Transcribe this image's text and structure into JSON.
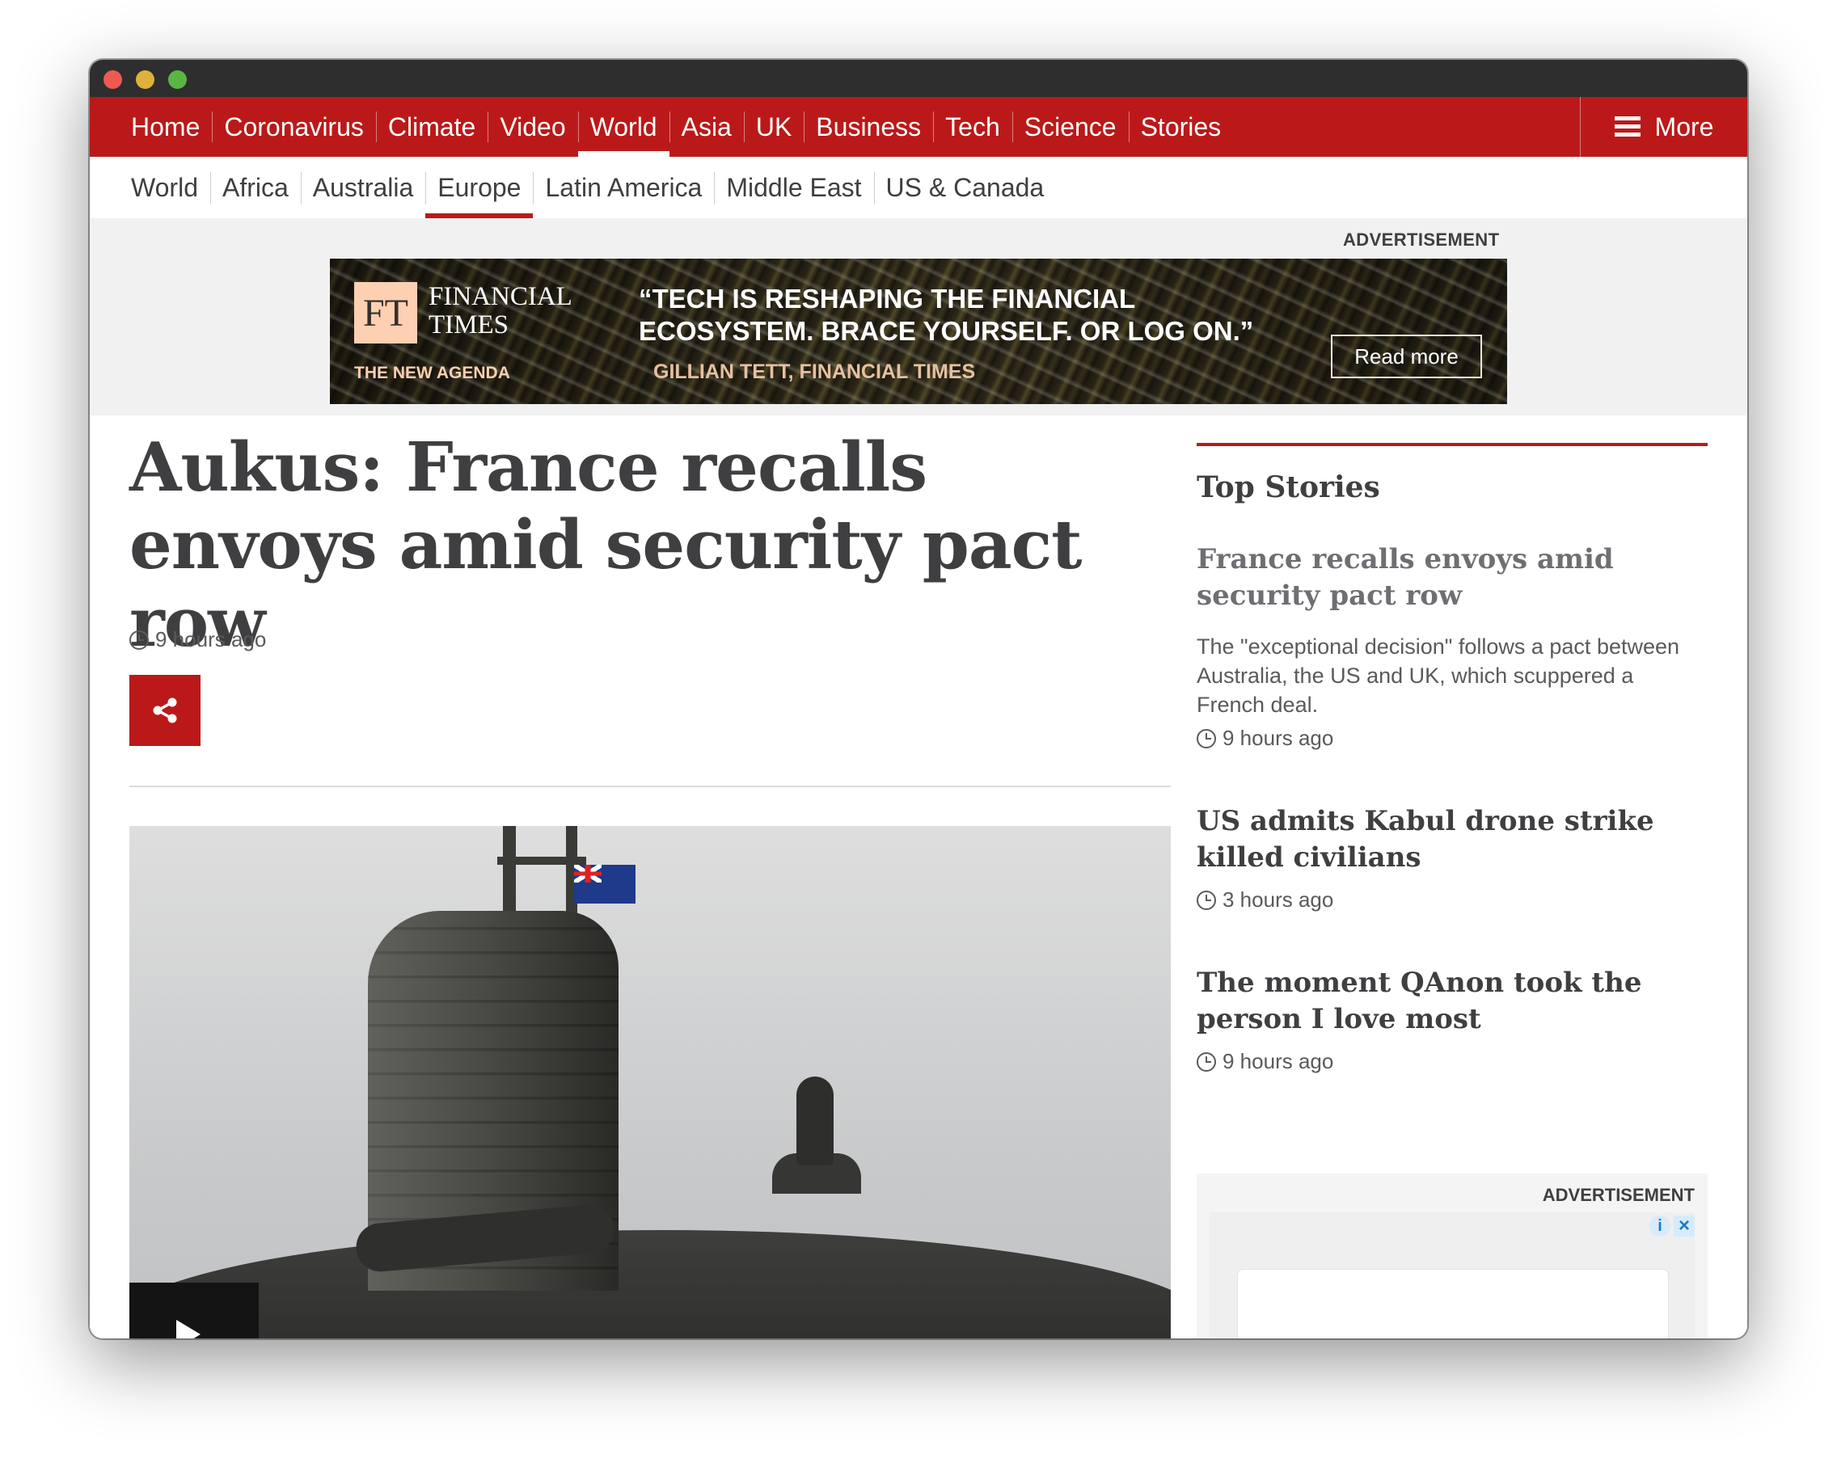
{
  "primary_nav": {
    "items": [
      "Home",
      "Coronavirus",
      "Climate",
      "Video",
      "World",
      "Asia",
      "UK",
      "Business",
      "Tech",
      "Science",
      "Stories"
    ],
    "active": "World",
    "more_label": "More"
  },
  "secondary_nav": {
    "items": [
      "World",
      "Africa",
      "Australia",
      "Europe",
      "Latin America",
      "Middle East",
      "US & Canada"
    ],
    "active": "Europe"
  },
  "top_ad": {
    "label": "ADVERTISEMENT",
    "logo_mark": "FT",
    "brand_line1": "FINANCIAL",
    "brand_line2": "TIMES",
    "tagline": "THE NEW AGENDA",
    "quote": "“TECH IS RESHAPING THE  FINANCIAL\n ECOSYSTEM. BRACE YOURSELF. OR LOG ON.”",
    "attribution": "GILLIAN TETT, FINANCIAL TIMES",
    "cta": "Read more"
  },
  "article": {
    "headline": "Aukus: France recalls envoys amid security pact row",
    "timestamp": "9 hours ago"
  },
  "sidebar": {
    "title": "Top Stories",
    "stories": [
      {
        "headline": "France recalls envoys amid security pact row",
        "summary": "The \"exceptional decision\" follows a pact between Australia, the US and UK, which scuppered a French deal.",
        "timestamp": "9 hours ago"
      },
      {
        "headline": "US admits Kabul drone strike killed civilians",
        "timestamp": "3 hours ago"
      },
      {
        "headline": "The moment QAnon took the person I love most",
        "timestamp": "9 hours ago"
      }
    ],
    "ad_label": "ADVERTISEMENT"
  },
  "colors": {
    "brand_red": "#bb1919",
    "text_dark": "#3f3f42",
    "ad_background": "#f1f1f1"
  },
  "icons": [
    "hamburger-icon",
    "clock-icon",
    "share-icon",
    "play-icon",
    "adchoices-icon",
    "close-icon"
  ]
}
